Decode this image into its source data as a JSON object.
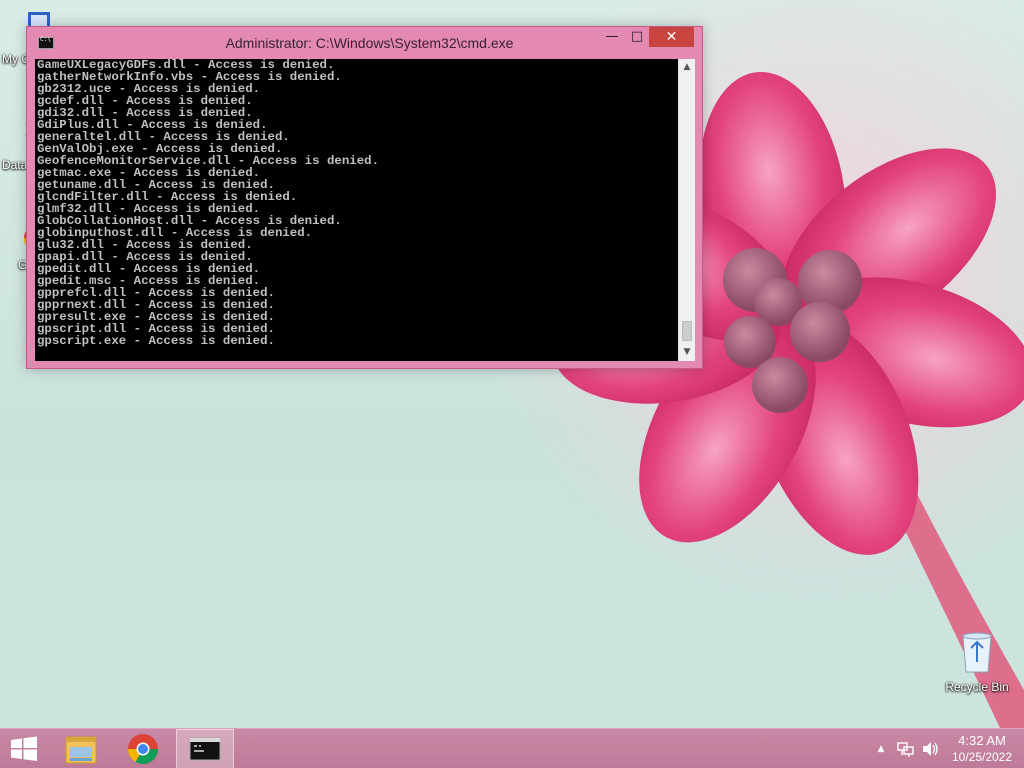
{
  "desktop": {
    "icons": [
      {
        "id": "my-computer",
        "label": "My C",
        "icon": "computer-icon"
      },
      {
        "id": "data",
        "label": "Data",
        "icon": "shortcut-icon"
      },
      {
        "id": "google-chrome",
        "label": "G",
        "icon": "chrome-icon"
      },
      {
        "id": "recycle-bin",
        "label": "Recycle Bin",
        "icon": "recycle-bin-icon"
      }
    ]
  },
  "window": {
    "title": "Administrator:  C:\\Windows\\System32\\cmd.exe",
    "minimize": "—",
    "maximize": "□",
    "close": "✕",
    "console_lines": [
      "GameUXLegacyGDFs.dll - Access is denied.",
      "gatherNetworkInfo.vbs - Access is denied.",
      "gb2312.uce - Access is denied.",
      "gcdef.dll - Access is denied.",
      "gdi32.dll - Access is denied.",
      "GdiPlus.dll - Access is denied.",
      "generaltel.dll - Access is denied.",
      "GenValObj.exe - Access is denied.",
      "GeofenceMonitorService.dll - Access is denied.",
      "getmac.exe - Access is denied.",
      "getuname.dll - Access is denied.",
      "glcndFilter.dll - Access is denied.",
      "glmf32.dll - Access is denied.",
      "GlobCollationHost.dll - Access is denied.",
      "globinputhost.dll - Access is denied.",
      "glu32.dll - Access is denied.",
      "gpapi.dll - Access is denied.",
      "gpedit.dll - Access is denied.",
      "gpedit.msc - Access is denied.",
      "gpprefcl.dll - Access is denied.",
      "gpprnext.dll - Access is denied.",
      "gpresult.exe - Access is denied.",
      "gpscript.dll - Access is denied.",
      "gpscript.exe - Access is denied."
    ],
    "scroll_up": "▲",
    "scroll_down": "▼"
  },
  "taskbar": {
    "items": [
      {
        "id": "start",
        "icon": "windows-start-icon"
      },
      {
        "id": "explorer",
        "icon": "file-explorer-icon"
      },
      {
        "id": "chrome",
        "icon": "chrome-icon"
      },
      {
        "id": "cmd",
        "icon": "cmd-icon",
        "active": true
      }
    ],
    "tray_arrow": "▲",
    "time": "4:32 AM",
    "date": "10/25/2022"
  },
  "colors": {
    "accent": "#e48ab2",
    "taskbar": "#c988a5",
    "close": "#c8443f",
    "console_bg": "#000000",
    "console_fg": "#c0c0c0"
  }
}
